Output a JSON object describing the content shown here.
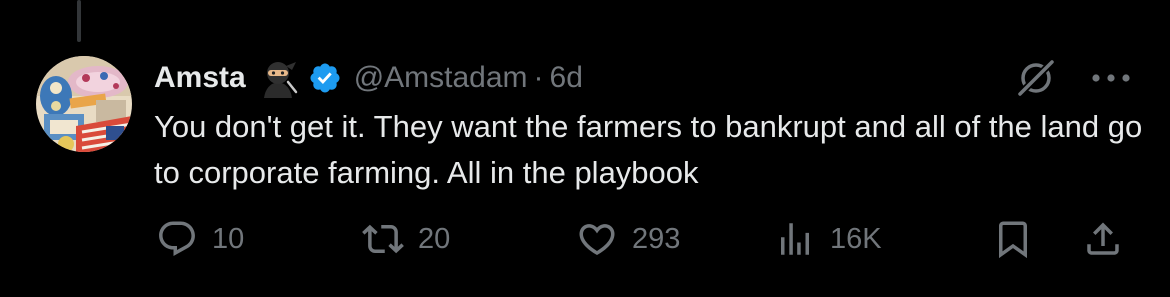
{
  "tweet": {
    "display_name": "Amsta",
    "handle": "@Amstadam",
    "separator": "·",
    "time": "6d",
    "text": "You don't get it. They want the farmers to bankrupt and all of the land go to corporate farming. All in the playbook",
    "verified": true,
    "name_emoji": "ninja"
  },
  "actions": {
    "replies": "10",
    "reposts": "20",
    "likes": "293",
    "views": "16K"
  },
  "icons": {
    "reply": "reply-icon",
    "repost": "repost-icon",
    "like": "heart-icon",
    "views": "views-chart-icon",
    "bookmark": "bookmark-icon",
    "share": "share-icon",
    "grok": "grok-icon",
    "more": "more-icon"
  },
  "colors": {
    "background": "#000000",
    "text": "#e7e9ea",
    "muted": "#71767b",
    "verified": "#1d9bf0"
  }
}
